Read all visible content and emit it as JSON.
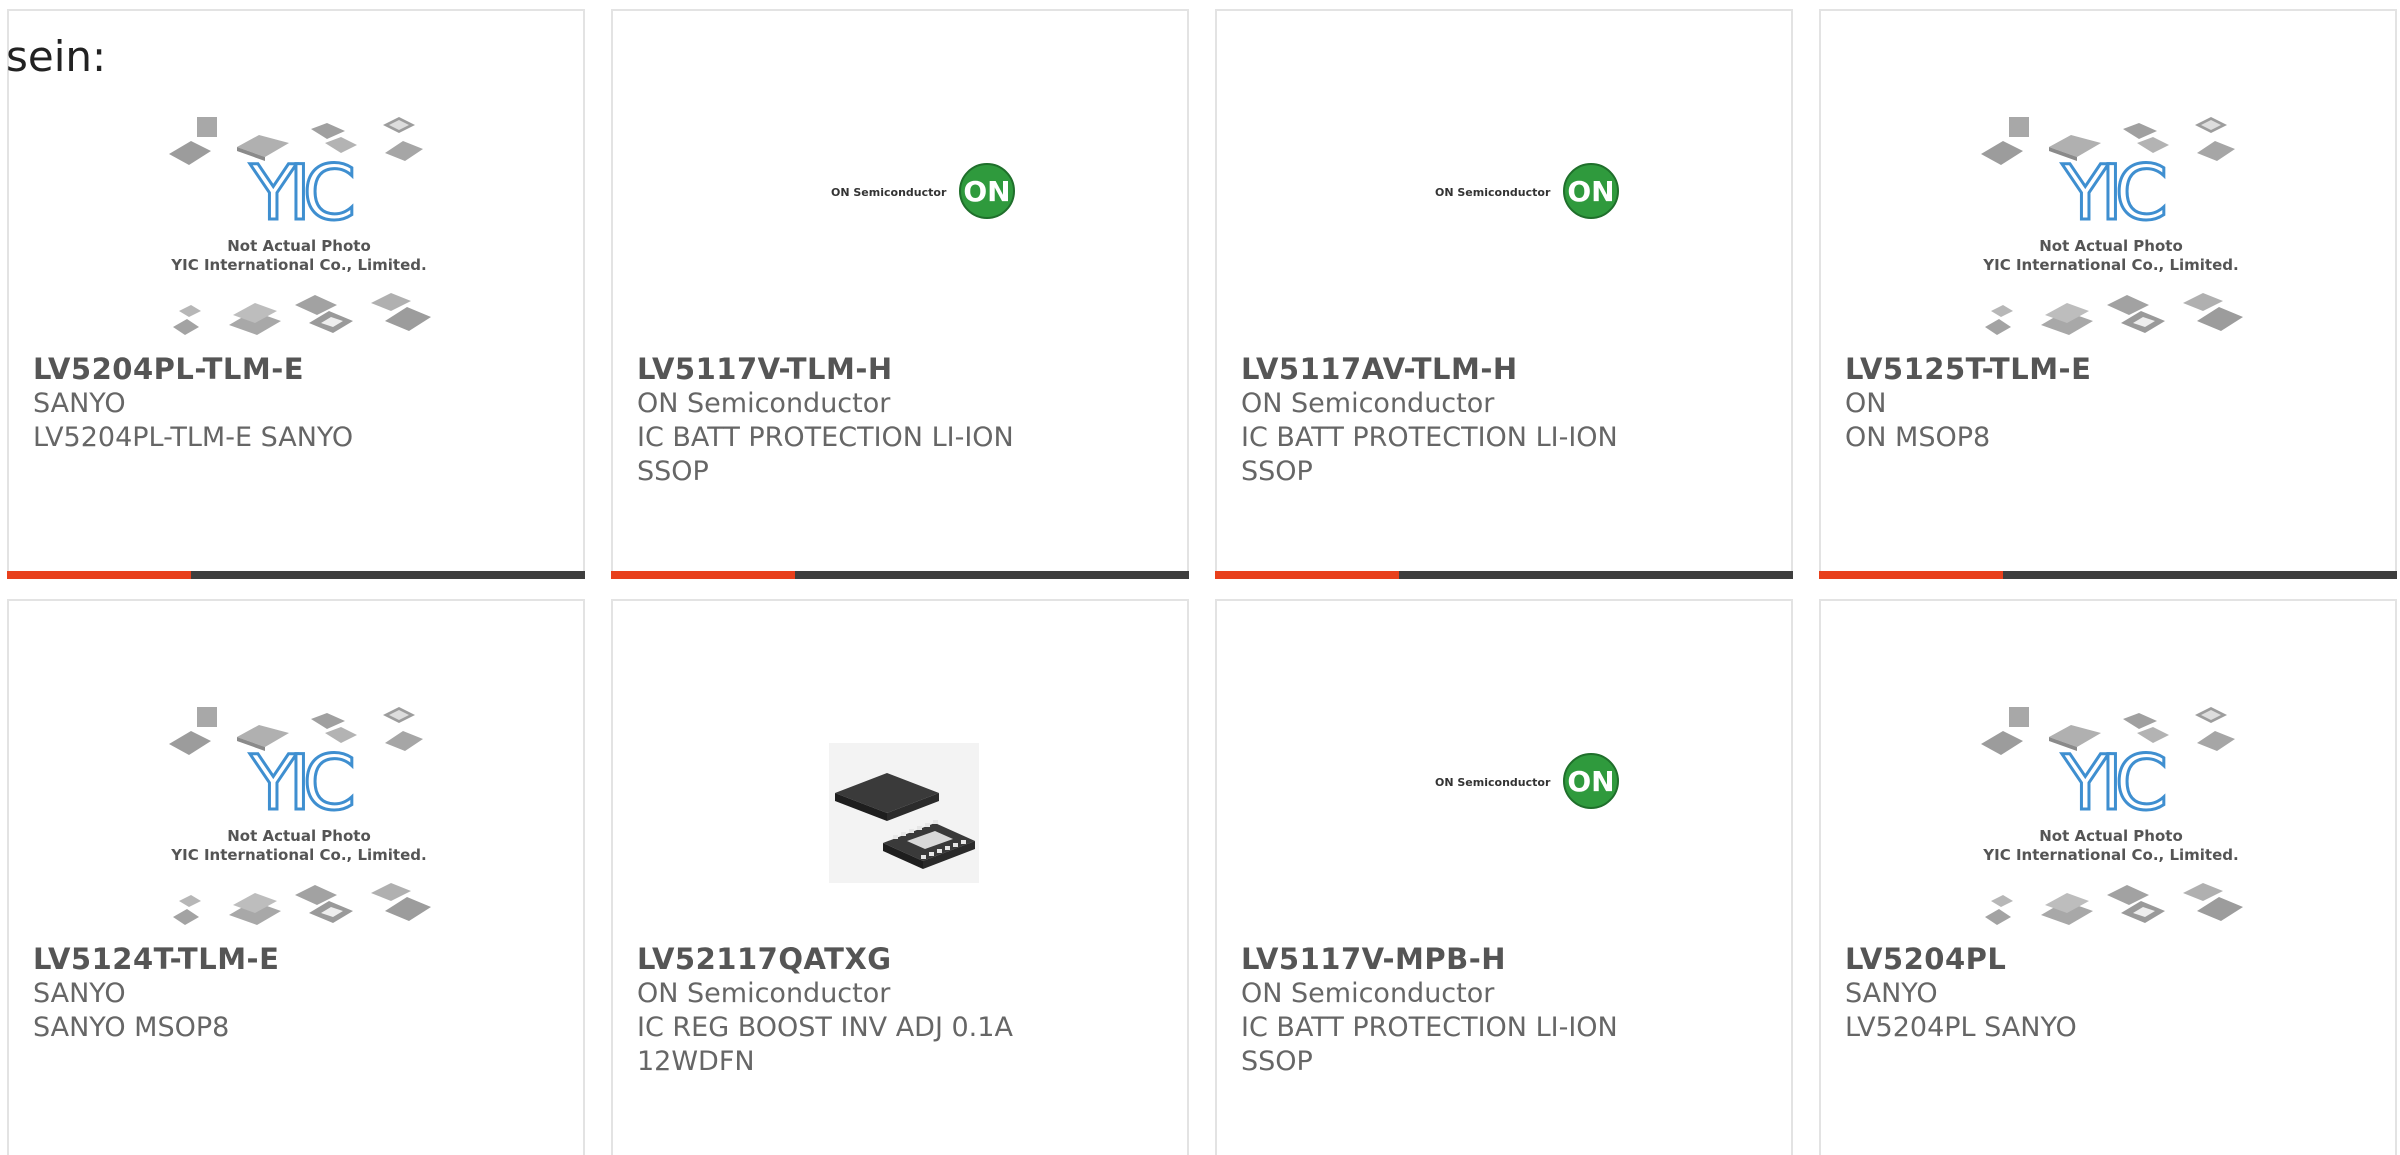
{
  "intro_text": "sein:",
  "accent_colors": {
    "orange": "#e8401c",
    "dark": "#3e3e3e"
  },
  "placeholder": {
    "brand": "YIC",
    "line1": "Not Actual Photo",
    "line2": "YIC International Co., Limited."
  },
  "on_logo": {
    "text": "ON Semiconductor",
    "badge": "ON",
    "color": "#2f9a3d"
  },
  "products": [
    {
      "part": "LV5204PL-TLM-E",
      "manufacturer": "SANYO",
      "description": "LV5204PL-TLM-E SANYO",
      "image": "yic-placeholder"
    },
    {
      "part": "LV5117V-TLM-H",
      "manufacturer": "ON Semiconductor",
      "description": "IC BATT PROTECTION LI-ION\nSSOP",
      "image": "on-semi-logo"
    },
    {
      "part": "LV5117AV-TLM-H",
      "manufacturer": "ON Semiconductor",
      "description": "IC BATT PROTECTION LI-ION\nSSOP",
      "image": "on-semi-logo"
    },
    {
      "part": "LV5125T-TLM-E",
      "manufacturer": "ON",
      "description": "ON MSOP8",
      "image": "yic-placeholder"
    },
    {
      "part": "LV5124T-TLM-E",
      "manufacturer": "SANYO",
      "description": "SANYO MSOP8",
      "image": "yic-placeholder"
    },
    {
      "part": "LV52117QATXG",
      "manufacturer": "ON Semiconductor",
      "description": "IC REG BOOST INV ADJ 0.1A\n12WDFN",
      "image": "wdfn-chip-photo"
    },
    {
      "part": "LV5117V-MPB-H",
      "manufacturer": "ON Semiconductor",
      "description": "IC BATT PROTECTION LI-ION\nSSOP",
      "image": "on-semi-logo"
    },
    {
      "part": "LV5204PL",
      "manufacturer": "SANYO",
      "description": "LV5204PL SANYO",
      "image": "yic-placeholder"
    }
  ]
}
